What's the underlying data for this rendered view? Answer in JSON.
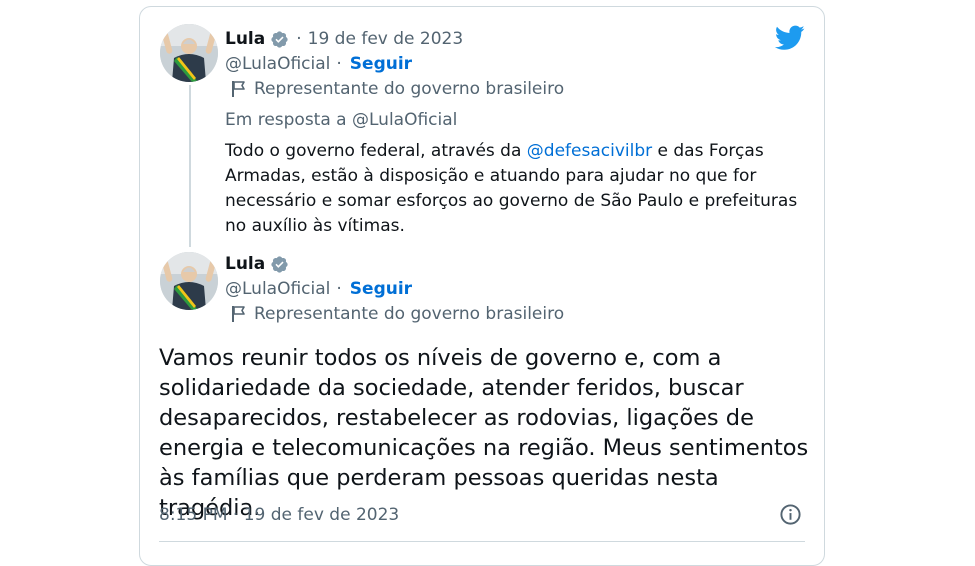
{
  "colors": {
    "accent": "#1d9bf0",
    "link": "#006fd6",
    "secondary_text": "#536471",
    "border": "#cfd9de"
  },
  "icons": {
    "logo": "twitter-bird-icon",
    "verified": "verified-badge-icon",
    "label": "flag-icon",
    "info": "info-icon"
  },
  "reply_tweet": {
    "author_name": "Lula",
    "separator": "·",
    "date": "19 de fev de 2023",
    "handle": "@LulaOficial",
    "follow_separator": "·",
    "follow_label": "Seguir",
    "gov_label": "Representante do governo brasileiro",
    "reply_to": "Em resposta a @LulaOficial",
    "text_before": "Todo o governo federal, através da ",
    "mention": "@defesacivilbr",
    "text_after": " e das Forças Armadas, estão à disposição e atuando para ajudar no que for necessário e somar esforços ao governo de São Paulo e prefeituras no auxílio às vítimas."
  },
  "main_tweet": {
    "author_name": "Lula",
    "handle": "@LulaOficial",
    "follow_separator": "·",
    "follow_label": "Seguir",
    "gov_label": "Representante do governo brasileiro",
    "text": "Vamos reunir todos os níveis de governo e, com a solidariedade da sociedade, atender feridos, buscar desaparecidos, restabelecer as rodovias, ligações de energia e telecomunicações na região. Meus sentimentos às famílias que perderam pessoas queridas nesta tragédia.",
    "timestamp": "8:15 PM · 19 de fev de 2023"
  }
}
